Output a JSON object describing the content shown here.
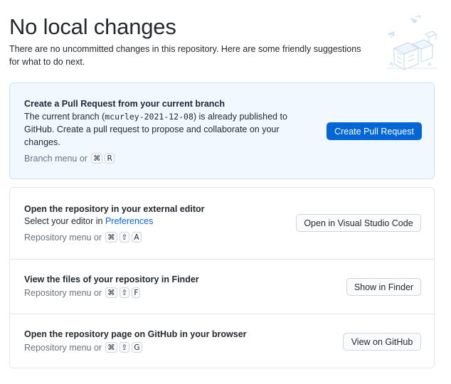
{
  "header": {
    "title": "No local changes",
    "subtitle_line1": "There are no uncommitted changes in this repository. Here are some friendly suggestions",
    "subtitle_line2": "for what to do next."
  },
  "pull_request": {
    "heading": "Create a Pull Request from your current branch",
    "line1_prefix": "The current branch (",
    "branch": "mcurley-2021-12-08",
    "line1_suffix": ") is already published to",
    "line2": "GitHub. Create a pull request to propose and collaborate on your",
    "line3": "changes.",
    "menu_label": "Branch menu or",
    "shortcut": [
      "⌘",
      "R"
    ],
    "button_label": "Create Pull Request"
  },
  "editor": {
    "heading": "Open the repository in your external editor",
    "text_prefix": "Select your editor in",
    "link_label": "Preferences",
    "menu_label": "Repository menu or",
    "shortcut": [
      "⌘",
      "⇧",
      "A"
    ],
    "button_label": "Open in Visual Studio Code"
  },
  "finder": {
    "heading": "View the files of your repository in Finder",
    "menu_label": "Repository menu or",
    "shortcut": [
      "⌘",
      "⇧",
      "F"
    ],
    "button_label": "Show in Finder"
  },
  "github": {
    "heading": "Open the repository page on GitHub in your browser",
    "menu_label": "Repository menu or",
    "shortcut": [
      "⌘",
      "⇧",
      "G"
    ],
    "button_label": "View on GitHub"
  },
  "colors": {
    "accent": "#0366d6",
    "primary_card_bg": "#f1f8ff",
    "border": "#e1e4e8"
  },
  "icons": [
    "no-changes-illustration"
  ]
}
